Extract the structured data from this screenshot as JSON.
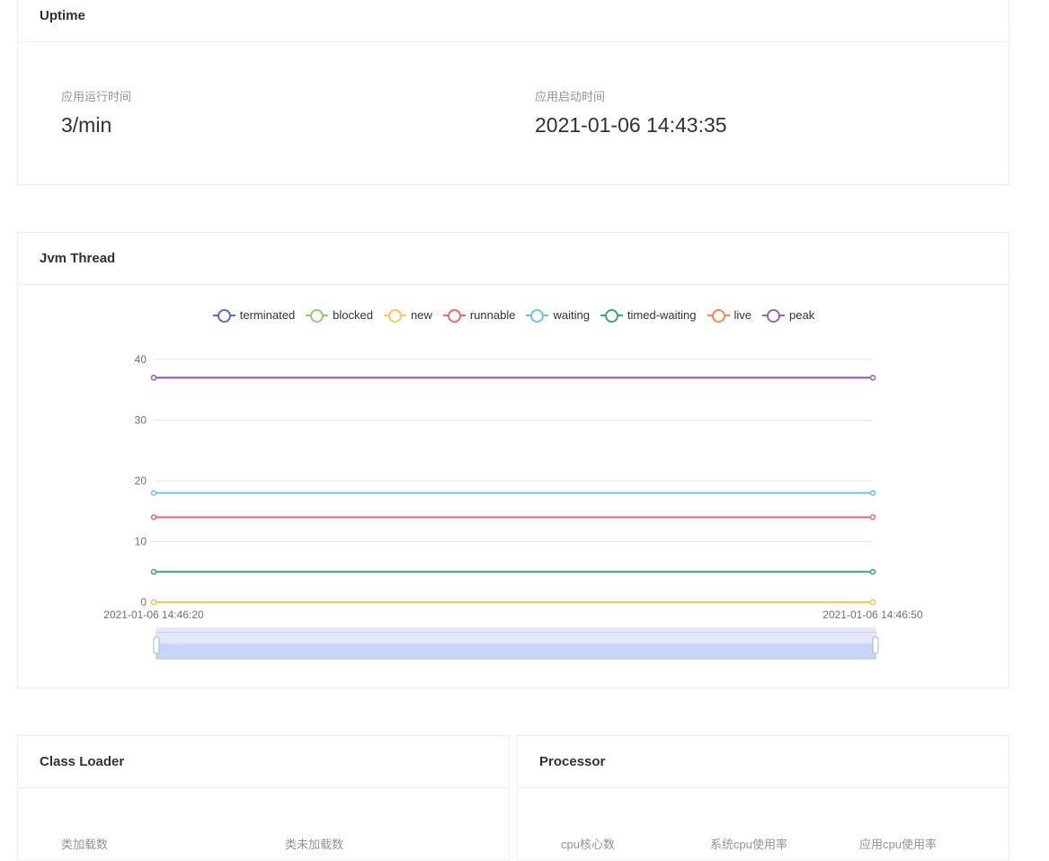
{
  "uptime": {
    "title": "Uptime",
    "run_time_label": "应用运行时间",
    "run_time_value": "3/min",
    "start_time_label": "应用启动时间",
    "start_time_value": "2021-01-06 14:43:35"
  },
  "jvm_thread": {
    "title": "Jvm Thread"
  },
  "class_loader": {
    "title": "Class Loader",
    "loaded_label": "类加载数",
    "unloaded_label": "类未加载数"
  },
  "processor": {
    "title": "Processor",
    "cores_label": "cpu核心数",
    "system_cpu_label": "系统cpu使用率",
    "app_cpu_label": "应用cpu使用率"
  },
  "chart_data": {
    "type": "line",
    "x": [
      "2021-01-06 14:46:20",
      "2021-01-06 14:46:50"
    ],
    "ylim": [
      0,
      40
    ],
    "yticks": [
      0,
      10,
      20,
      30,
      40
    ],
    "grid": true,
    "legend_placement": "top-center",
    "has_data_zoom_slider": true,
    "series": [
      {
        "name": "terminated",
        "color": "#5470c6",
        "values": [
          0,
          0
        ]
      },
      {
        "name": "blocked",
        "color": "#91cc75",
        "values": [
          0,
          0
        ]
      },
      {
        "name": "new",
        "color": "#fac858",
        "values": [
          0,
          0
        ]
      },
      {
        "name": "runnable",
        "color": "#ee6666",
        "values": [
          14,
          14
        ]
      },
      {
        "name": "waiting",
        "color": "#73c0de",
        "values": [
          18,
          18
        ]
      },
      {
        "name": "timed-waiting",
        "color": "#3ba272",
        "values": [
          5,
          5
        ]
      },
      {
        "name": "live",
        "color": "#fc8452",
        "values": [
          37,
          37
        ]
      },
      {
        "name": "peak",
        "color": "#9a60b4",
        "values": [
          37,
          37
        ]
      }
    ]
  }
}
